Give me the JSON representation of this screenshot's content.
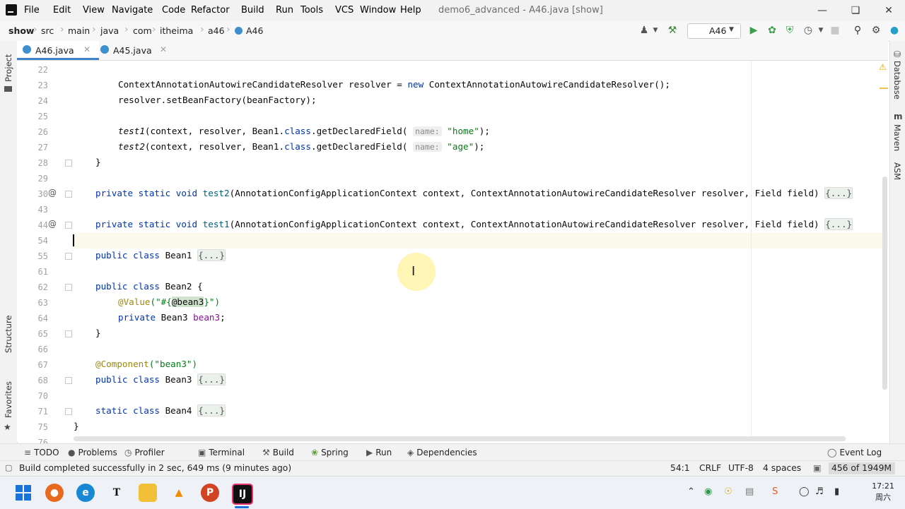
{
  "app": {
    "menus": [
      "File",
      "Edit",
      "View",
      "Navigate",
      "Code",
      "Refactor",
      "Build",
      "Run",
      "Tools",
      "VCS",
      "Window",
      "Help"
    ],
    "window_title": "demo6_advanced - A46.java [show]"
  },
  "breadcrumbs": [
    "show",
    "src",
    "main",
    "java",
    "com",
    "itheima",
    "a46",
    "A46"
  ],
  "run_config": "A46",
  "tabs": [
    {
      "label": "A46.java",
      "active": true
    },
    {
      "label": "A45.java",
      "active": false
    }
  ],
  "left_tools": [
    "Project",
    "Structure",
    "Favorites"
  ],
  "right_tools": [
    "Database",
    "Maven",
    "ASM"
  ],
  "editor": {
    "line_numbers": [
      "22",
      "23",
      "24",
      "25",
      "26",
      "27",
      "28",
      "29",
      "30",
      "43",
      "44",
      "54",
      "55",
      "61",
      "62",
      "63",
      "64",
      "65",
      "66",
      "67",
      "68",
      "70",
      "71",
      "75",
      "76"
    ],
    "code": {
      "l23_type": "ContextAnnotationAutowireCandidateResolver resolver = ",
      "l23_new": "new",
      "l23_rest": " ContextAnnotationAutowireCandidateResolver();",
      "l24": "resolver.setBeanFactory(beanFactory);",
      "l26_fn": "test1",
      "l27_fn": "test2",
      "l26_args": "(context, resolver, Bean1.",
      "l26_class": "class",
      "l26_call": ".getDeclaredField(",
      "hint_name": "name:",
      "l26_str": "\"home\"",
      "l27_str": "\"age\"",
      "close_call": ");",
      "close_brace": "}",
      "priv_kw": "private static void",
      "l30_fn": "test2",
      "l44_fn": "test1",
      "method_params": "(AnnotationConfigApplicationContext context, ContextAnnotationAutowireCandidateResolver resolver, Field field) ",
      "fold_body": "{...}",
      "public_class": "public class",
      "static_class": "static class",
      "bean1": " Bean1 ",
      "bean2": " Bean2 {",
      "bean3_decl": " Bean3 ",
      "bean4": " Bean4 ",
      "value_ann": "@Value",
      "value_arg_open": "(\"#{",
      "value_arg_inner": "@bean3",
      "value_arg_close": "}\")",
      "private_kw": "private",
      "bean3_type": " Bean3 ",
      "bean3_field": "bean3",
      "semicolon": ";",
      "component_ann": "@Component",
      "component_arg": "(\"bean3\")"
    }
  },
  "bottom_tools": [
    "TODO",
    "Problems",
    "Profiler",
    "Terminal",
    "Build",
    "Spring",
    "Run",
    "Dependencies",
    "Event Log"
  ],
  "status": {
    "message": "Build completed successfully in 2 sec, 649 ms (9 minutes ago)",
    "position": "54:1",
    "line_sep": "CRLF",
    "encoding": "UTF-8",
    "indent": "4 spaces",
    "memory": "456 of 1949M"
  },
  "clock": {
    "time": "17:21",
    "day": "周六"
  },
  "colors": {
    "keyword": "#0033b3",
    "string": "#067d17",
    "annotation": "#9e880d",
    "field": "#871094",
    "accent": "#4083c9"
  }
}
